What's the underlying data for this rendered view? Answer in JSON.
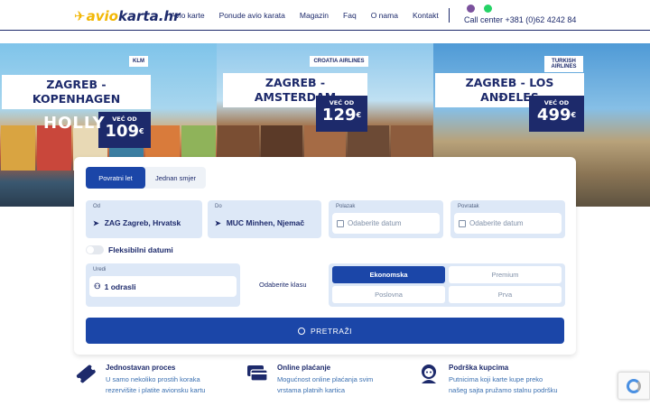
{
  "header": {
    "logo_prefix": "✈",
    "logo_main": "avio",
    "logo_suffix": "karta.hr",
    "nav": [
      "Avio karte",
      "Ponude avio karata",
      "Magazin",
      "Faq",
      "O nama",
      "Kontakt"
    ],
    "callcenter": "Call center +381 (0)62 4242 84"
  },
  "hero": {
    "panels": [
      {
        "title_line1": "ZAGREB -",
        "title_line2": "KOPENHAGEN",
        "airline": "KLM",
        "from_label": "VEĆ OD",
        "price": "109",
        "currency": "€"
      },
      {
        "title_line1": "ZAGREB - AMSTERDAM",
        "title_line2": "",
        "airline": "CROATIA AIRLINES",
        "from_label": "VEĆ OD",
        "price": "129",
        "currency": "€"
      },
      {
        "title_line1": "ZAGREB - LOS ANĐELES",
        "title_line2": "",
        "airline": "TURKISH AIRLINES",
        "from_label": "VEĆ OD",
        "price": "499",
        "currency": "€"
      }
    ],
    "hollywood_sign": "HOLLY"
  },
  "search": {
    "tabs": [
      "Povratni let",
      "Jednan smjer"
    ],
    "from": {
      "label": "Od",
      "value": "ZAG Zagreb, Hrvatsk"
    },
    "to": {
      "label": "Do",
      "value": "MUC Minhen, Njemač"
    },
    "depart": {
      "label": "Polazak",
      "placeholder": "Odaberite datum"
    },
    "return": {
      "label": "Povratak",
      "placeholder": "Odaberite datum"
    },
    "flexible_label": "Fleksibilni datumi",
    "passengers": {
      "label": "Uredi",
      "value": "1 odrasli"
    },
    "class_label": "Odaberite klasu",
    "classes": [
      "Ekonomska",
      "Premium",
      "Poslovna",
      "Prva"
    ],
    "selected_class": "Ekonomska",
    "search_button": "PRETRAŽI"
  },
  "features": [
    {
      "title": "Jednostavan proces",
      "desc": "U samo nekoliko prostih koraka rezervišite i platite avionsku kartu"
    },
    {
      "title": "Online plaćanje",
      "desc": "Mogućnost online plaćanja svim vrstama platnih kartica"
    },
    {
      "title": "Podrška kupcima",
      "desc": "Putnicima koji karte kupe preko našeg sajta pružamo stalnu podršku"
    }
  ],
  "colors": {
    "brand": "#1d2a6b",
    "accent": "#f2b705",
    "button": "#1b46a8",
    "field_bg": "#dde8f7"
  }
}
